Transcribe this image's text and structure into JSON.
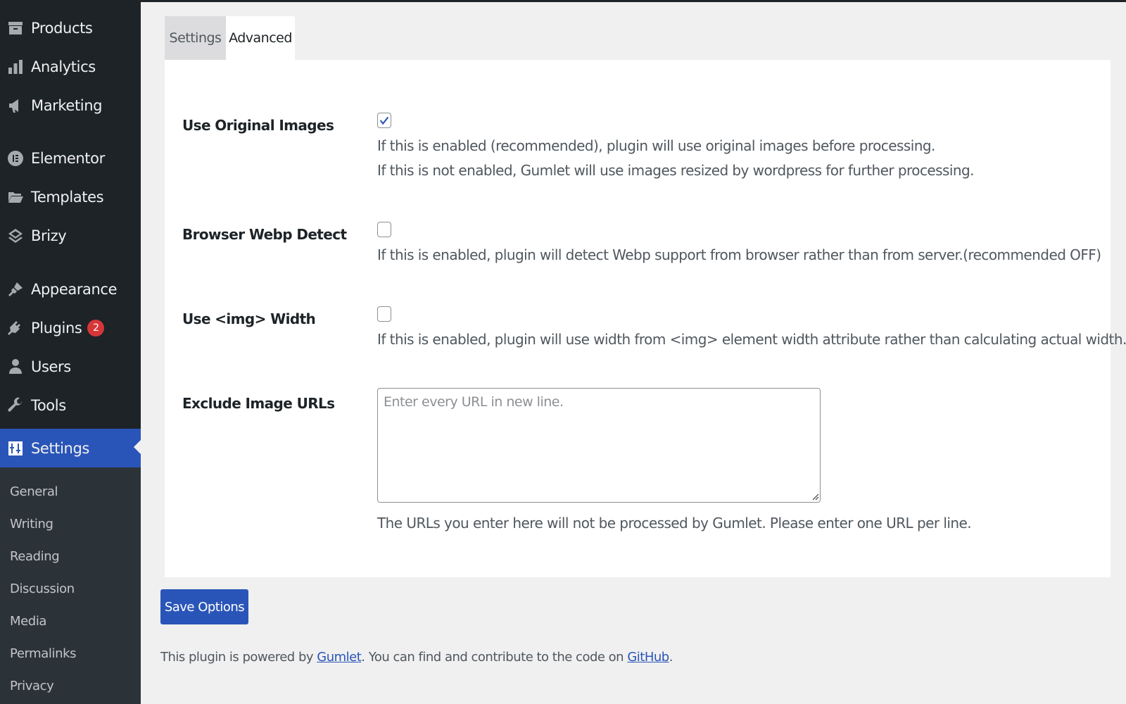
{
  "sidebar": {
    "items": [
      {
        "label": "Products",
        "icon": "archive-icon"
      },
      {
        "label": "Analytics",
        "icon": "bar-chart-icon"
      },
      {
        "label": "Marketing",
        "icon": "megaphone-icon"
      },
      {
        "label": "Elementor",
        "icon": "elementor-icon"
      },
      {
        "label": "Templates",
        "icon": "folder-icon"
      },
      {
        "label": "Brizy",
        "icon": "layers-icon"
      },
      {
        "label": "Appearance",
        "icon": "paintbrush-icon"
      },
      {
        "label": "Plugins",
        "icon": "plug-icon",
        "badge": "2"
      },
      {
        "label": "Users",
        "icon": "user-icon"
      },
      {
        "label": "Tools",
        "icon": "wrench-icon"
      },
      {
        "label": "Settings",
        "icon": "settings-icon",
        "active": true
      }
    ],
    "submenu": [
      "General",
      "Writing",
      "Reading",
      "Discussion",
      "Media",
      "Permalinks",
      "Privacy"
    ]
  },
  "tabs": [
    {
      "label": "Settings",
      "active": false
    },
    {
      "label": "Advanced",
      "active": true
    }
  ],
  "options": {
    "use_original_images": {
      "label": "Use Original Images",
      "checked": true,
      "desc_line1": "If this is enabled (recommended), plugin will use original images before processing.",
      "desc_line2": "If this is not enabled, Gumlet will use images resized by wordpress for further processing."
    },
    "browser_webp_detect": {
      "label": "Browser Webp Detect",
      "checked": false,
      "desc": "If this is enabled, plugin will detect Webp support from browser rather than from server.(recommended OFF)"
    },
    "use_img_width": {
      "label": "Use <img> Width",
      "checked": false,
      "desc": "If this is enabled, plugin will use width from <img> element width attribute rather than calculating actual width."
    },
    "exclude_image_urls": {
      "label": "Exclude Image URLs",
      "placeholder": "Enter every URL in new line.",
      "value": "",
      "desc": "The URLs you enter here will not be processed by Gumlet. Please enter one URL per line."
    }
  },
  "save_button": "Save Options",
  "footer": {
    "prefix": "This plugin is powered by ",
    "link1": "Gumlet",
    "middle": ". You can find and contribute to the code on ",
    "link2": "GitHub",
    "suffix": "."
  },
  "colors": {
    "sidebar_bg": "#1d2327",
    "submenu_bg": "#2c3338",
    "accent": "#2a55b8",
    "badge": "#d63638"
  }
}
